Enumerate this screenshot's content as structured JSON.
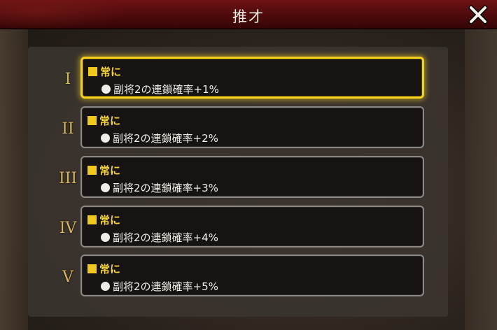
{
  "header": {
    "title": "推才"
  },
  "rows": [
    {
      "numeral": "I",
      "condition": "常に",
      "effect": "副将2の連鎖確率+1%",
      "selected": true
    },
    {
      "numeral": "II",
      "condition": "常に",
      "effect": "副将2の連鎖確率+2%",
      "selected": false
    },
    {
      "numeral": "III",
      "condition": "常に",
      "effect": "副将2の連鎖確率+3%",
      "selected": false
    },
    {
      "numeral": "IV",
      "condition": "常に",
      "effect": "副将2の連鎖確率+4%",
      "selected": false
    },
    {
      "numeral": "V",
      "condition": "常に",
      "effect": "副将2の連鎖確率+5%",
      "selected": false
    }
  ],
  "colors": {
    "header_red": "#5e0d0f",
    "numeral_gold": "#d8b65a",
    "condition_yellow": "#f3d23a",
    "selected_border": "#f5d21c",
    "card_border": "#8a8784"
  },
  "icons": {
    "close": "close-x-icon",
    "condition_marker": "yellow-square-icon",
    "bullet": "white-circle-icon"
  }
}
